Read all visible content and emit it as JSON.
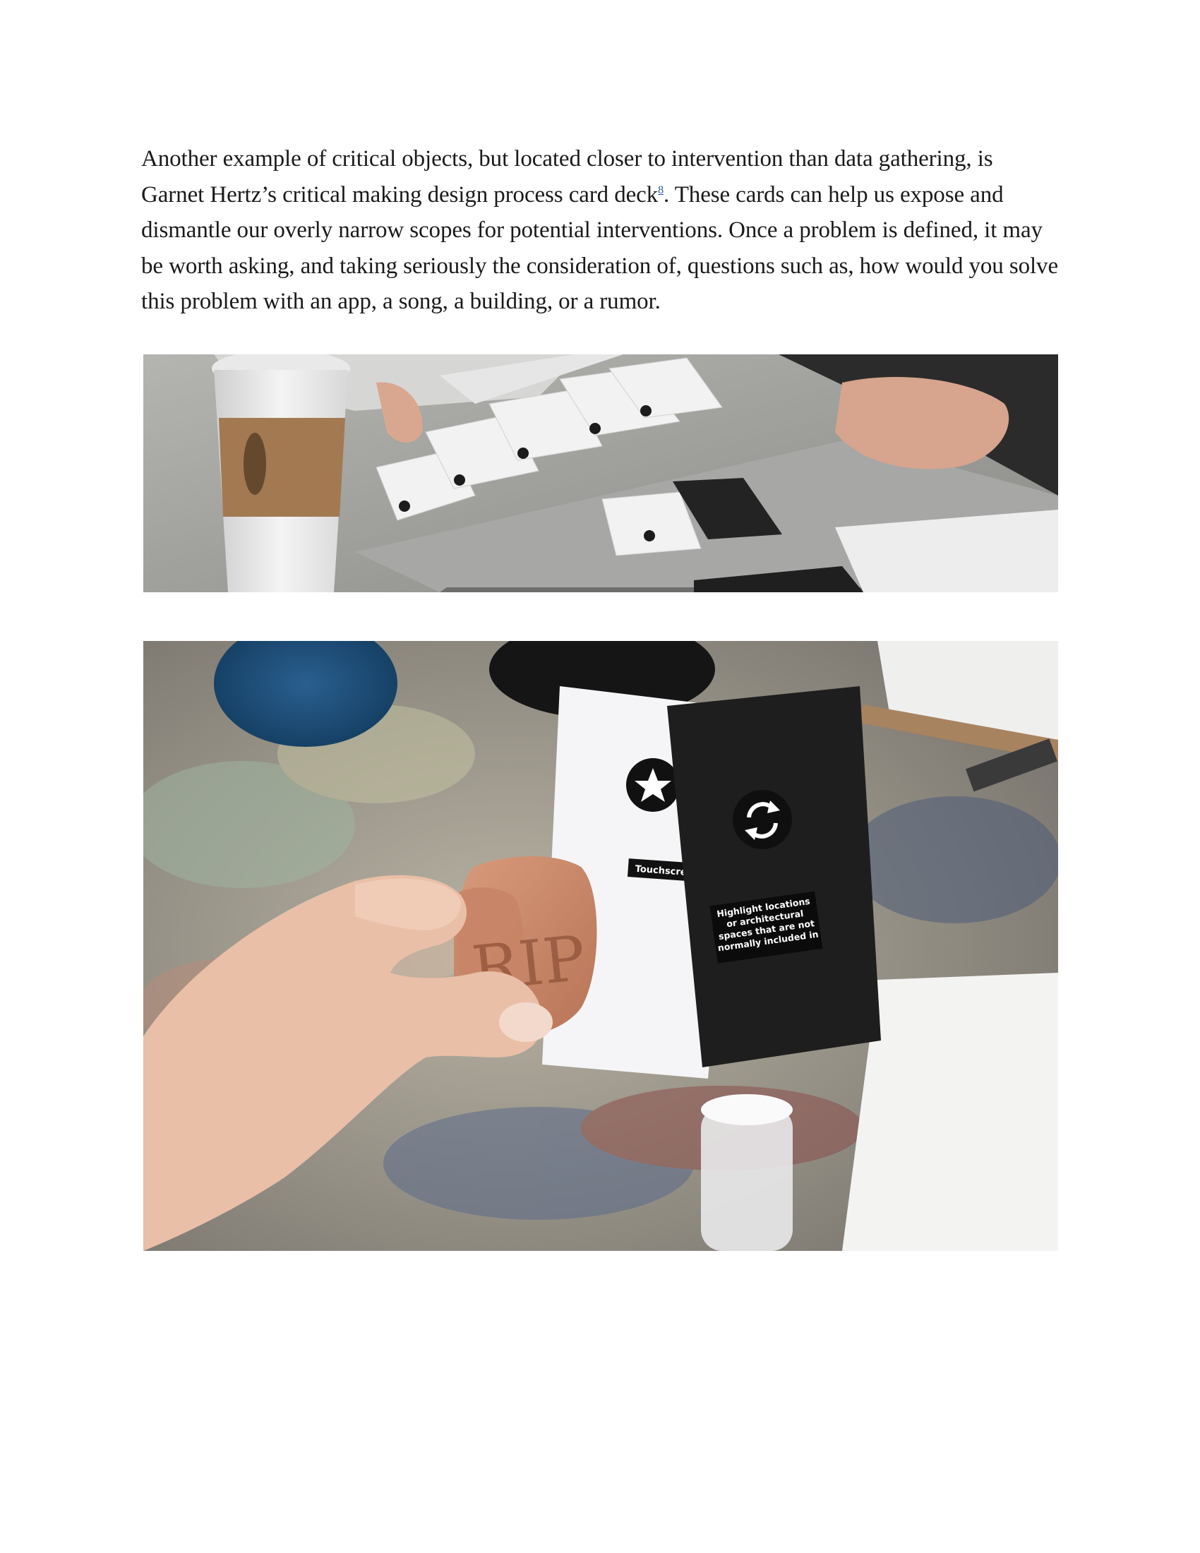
{
  "document": {
    "paragraph": {
      "text_before_ref": "Another example of critical objects, but located closer to intervention than data gathering, is Garnet Hertz’s critical making design process card deck",
      "footnote_ref": "8",
      "text_after_ref": ". These cards can help us expose and dismantle our overly narrow scopes for potential interventions. Once a problem is defined, it may be worth asking, and taking seriously the consideration of, questions such as, how would you solve this problem with an app, a song, a building, or a rumor."
    },
    "photo2": {
      "white_card_label": "Touchscreen",
      "black_card_text": [
        "Highlight locations",
        "or architectural",
        "spaces that are not",
        "normally included in"
      ],
      "clay_text": "RIP"
    }
  },
  "colors": {
    "text": "#1a1a1a",
    "footnote_link": "#2b5aa8",
    "black_card": "#1e1e1e",
    "clay": "#c98a6c"
  },
  "icons": [
    "star-icon",
    "refresh-icon"
  ]
}
